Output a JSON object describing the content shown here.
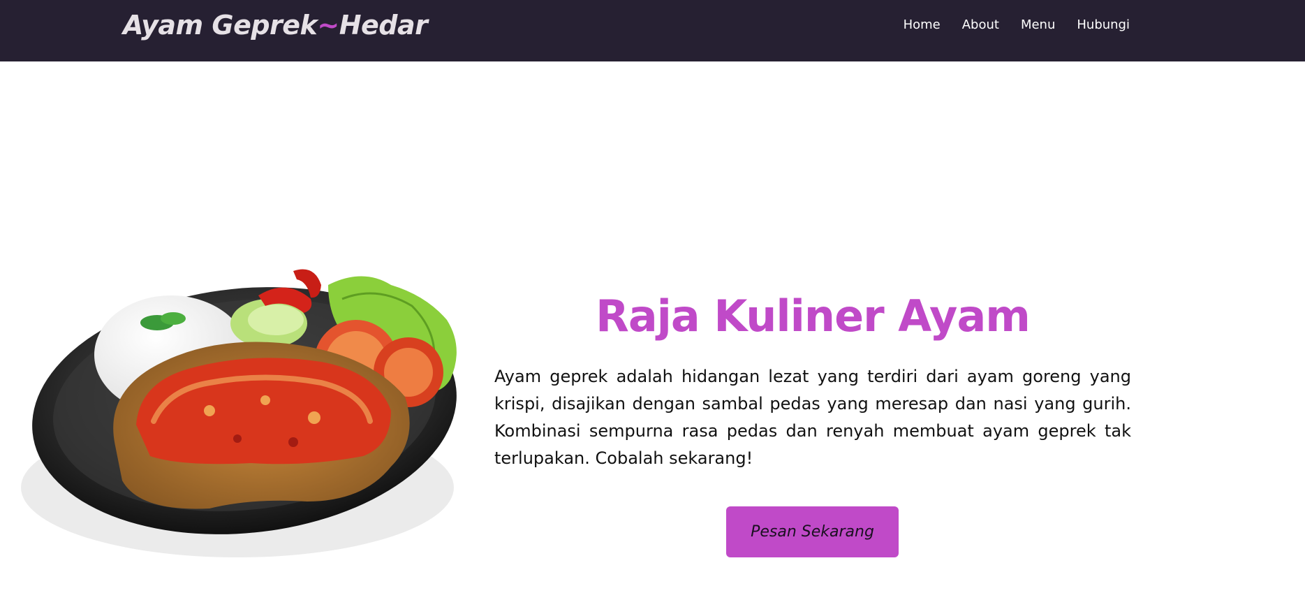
{
  "navbar": {
    "brand_part1": "Ayam Geprek",
    "brand_separator": "~",
    "brand_part2": "Hedar",
    "links": [
      "Home",
      "About",
      "Menu",
      "Hubungi"
    ]
  },
  "hero": {
    "title": "Raja Kuliner Ayam",
    "description": "Ayam geprek adalah hidangan lezat yang terdiri dari ayam goreng yang krispi, disajikan dengan sambal pedas yang meresap dan nasi yang gurih. Kombinasi sempurna rasa pedas dan renyah membuat ayam geprek tak terlupakan. Cobalah sekarang!",
    "cta_label": "Pesan Sekarang"
  },
  "colors": {
    "navbar_bg": "#262032",
    "accent": "#c04ac8",
    "brand_text": "#e6e1e6"
  }
}
